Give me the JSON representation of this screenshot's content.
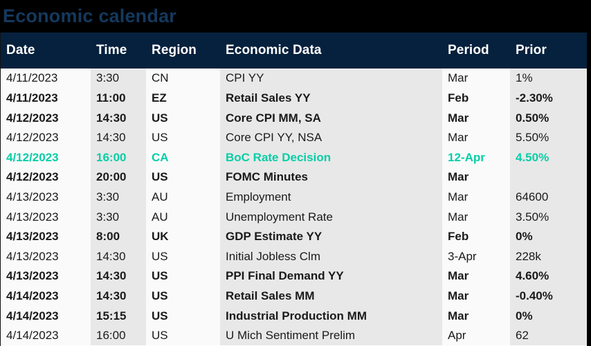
{
  "title": "Economic calendar",
  "theme": {
    "background": "#000000",
    "title_color": "#14395e",
    "header_background": "#06213d",
    "header_text": "#ffffff",
    "row_light": "#fafafa",
    "row_shade": "#e8e8e8",
    "text_color": "#1a1a1a",
    "highlight_color": "#05cfa6"
  },
  "table": {
    "columns": [
      {
        "key": "date",
        "label": "Date",
        "shaded": false
      },
      {
        "key": "time",
        "label": "Time",
        "shaded": true
      },
      {
        "key": "region",
        "label": "Region",
        "shaded": false
      },
      {
        "key": "data",
        "label": "Economic Data",
        "shaded": true
      },
      {
        "key": "period",
        "label": "Period",
        "shaded": false
      },
      {
        "key": "prior",
        "label": "Prior",
        "shaded": true
      }
    ],
    "rows": [
      {
        "date": "4/11/2023",
        "time": "3:30",
        "region": "CN",
        "data": "CPI YY",
        "period": "Mar",
        "prior": "1%",
        "bold": false,
        "highlight": false
      },
      {
        "date": "4/11/2023",
        "time": "11:00",
        "region": "EZ",
        "data": "Retail Sales YY",
        "period": "Feb",
        "prior": "-2.30%",
        "bold": true,
        "highlight": false
      },
      {
        "date": "4/12/2023",
        "time": "14:30",
        "region": "US",
        "data": "Core CPI MM, SA",
        "period": "Mar",
        "prior": "0.50%",
        "bold": true,
        "highlight": false
      },
      {
        "date": "4/12/2023",
        "time": "14:30",
        "region": "US",
        "data": "Core CPI YY, NSA",
        "period": "Mar",
        "prior": "5.50%",
        "bold": false,
        "highlight": false
      },
      {
        "date": "4/12/2023",
        "time": "16:00",
        "region": "CA",
        "data": "BoC Rate Decision",
        "period": "12-Apr",
        "prior": "4.50%",
        "bold": true,
        "highlight": true
      },
      {
        "date": "4/12/2023",
        "time": "20:00",
        "region": "US",
        "data": "FOMC Minutes",
        "period": "Mar",
        "prior": "",
        "bold": true,
        "highlight": false
      },
      {
        "date": "4/13/2023",
        "time": "3:30",
        "region": "AU",
        "data": "Employment",
        "period": "Mar",
        "prior": "64600",
        "bold": false,
        "highlight": false
      },
      {
        "date": "4/13/2023",
        "time": "3:30",
        "region": "AU",
        "data": "Unemployment Rate",
        "period": "Mar",
        "prior": "3.50%",
        "bold": false,
        "highlight": false
      },
      {
        "date": "4/13/2023",
        "time": "8:00",
        "region": "UK",
        "data": "GDP Estimate YY",
        "period": "Feb",
        "prior": "0%",
        "bold": true,
        "highlight": false
      },
      {
        "date": "4/13/2023",
        "time": "14:30",
        "region": "US",
        "data": "Initial Jobless Clm",
        "period": "3-Apr",
        "prior": "228k",
        "bold": false,
        "highlight": false
      },
      {
        "date": "4/13/2023",
        "time": "14:30",
        "region": "US",
        "data": "PPI Final Demand YY",
        "period": "Mar",
        "prior": "4.60%",
        "bold": true,
        "highlight": false
      },
      {
        "date": "4/14/2023",
        "time": "14:30",
        "region": "US",
        "data": "Retail Sales MM",
        "period": "Mar",
        "prior": "-0.40%",
        "bold": true,
        "highlight": false
      },
      {
        "date": "4/14/2023",
        "time": "15:15",
        "region": "US",
        "data": "Industrial Production MM",
        "period": "Mar",
        "prior": "0%",
        "bold": true,
        "highlight": false
      },
      {
        "date": "4/14/2023",
        "time": "16:00",
        "region": "US",
        "data": "U Mich Sentiment Prelim",
        "period": "Apr",
        "prior": "62",
        "bold": false,
        "highlight": false
      }
    ]
  }
}
